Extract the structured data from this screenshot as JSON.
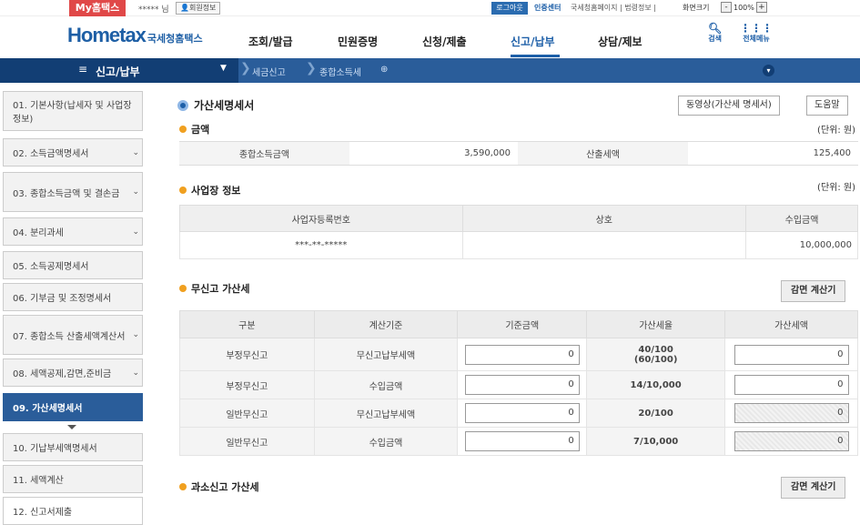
{
  "util": {
    "my_tax": "My홈택스",
    "username": "***** 님",
    "user_info": "회원정보",
    "logout": "로그아웃",
    "cert": "인증센터",
    "links": "국세청홈페이지 | 법령정보 |",
    "screen_size": "화면크기",
    "zoom_minus": "-",
    "zoom": "100%",
    "zoom_plus": "+"
  },
  "header": {
    "logo": "Hometax",
    "logo_sub": "국세청홈택스",
    "nav": [
      "조회/발급",
      "민원증명",
      "신청/제출",
      "신고/납부",
      "상담/제보"
    ],
    "search": "검색",
    "all_menu": "전체메뉴",
    "active_nav": "신고/납부"
  },
  "locbar": {
    "menu_label": "신고/납부",
    "crumbs": [
      "세금신고",
      "종합소득세"
    ]
  },
  "sidebar": {
    "items": [
      {
        "label": "01. 기본사항(납세자 및 사업장정보)",
        "chevron": false
      },
      {
        "label": "02. 소득금액명세서",
        "chevron": true
      },
      {
        "label": "03. 종합소득금액 및 결손금",
        "chevron": true
      },
      {
        "label": "04. 분리과세",
        "chevron": true
      },
      {
        "label": "05. 소득공제명세서",
        "chevron": false
      },
      {
        "label": "06. 기부금 및 조정명세서",
        "chevron": false
      },
      {
        "label": "07. 종합소득 산출세액계산서",
        "chevron": true
      },
      {
        "label": "08. 세액공제,감면,준비금",
        "chevron": true
      },
      {
        "label": "09. 가산세명세서",
        "chevron": false
      },
      {
        "label": "10. 기납부세액명세서",
        "chevron": false
      },
      {
        "label": "11. 세액계산",
        "chevron": false
      },
      {
        "label": "12. 신고서제출",
        "chevron": false
      }
    ],
    "active_index": 8
  },
  "main": {
    "title": "가산세명세서",
    "video_btn": "동영상(가산세 명세서)",
    "help_btn": "도움말",
    "amount": {
      "title": "금액",
      "unit": "(단위: 원)",
      "income_label": "종합소득금액",
      "income_value": "3,590,000",
      "tax_label": "산출세액",
      "tax_value": "125,400"
    },
    "biz": {
      "title": "사업장 정보",
      "unit": "(단위: 원)",
      "headers": [
        "사업자등록번호",
        "상호",
        "수입금액"
      ],
      "row": [
        "***-**-*****",
        "",
        "10,000,000"
      ]
    },
    "nonfiling": {
      "title": "무신고 가산세",
      "calc_btn": "감면 계산기",
      "headers": [
        "구분",
        "계산기준",
        "기준금액",
        "가산세율",
        "가산세액"
      ],
      "rows": [
        {
          "type": "부정무신고",
          "basis": "무신고납부세액",
          "amount": "0",
          "rate": "40/100",
          "rate2": "(60/100)",
          "tax": "0",
          "disabled": false
        },
        {
          "type": "부정무신고",
          "basis": "수입금액",
          "amount": "0",
          "rate": "14/10,000",
          "rate2": "",
          "tax": "0",
          "disabled": false
        },
        {
          "type": "일반무신고",
          "basis": "무신고납부세액",
          "amount": "0",
          "rate": "20/100",
          "rate2": "",
          "tax": "0",
          "disabled": true
        },
        {
          "type": "일반무신고",
          "basis": "수입금액",
          "amount": "0",
          "rate": "7/10,000",
          "rate2": "",
          "tax": "0",
          "disabled": true
        }
      ]
    },
    "underreport": {
      "title": "과소신고 가산세",
      "calc_btn": "감면 계산기"
    }
  }
}
